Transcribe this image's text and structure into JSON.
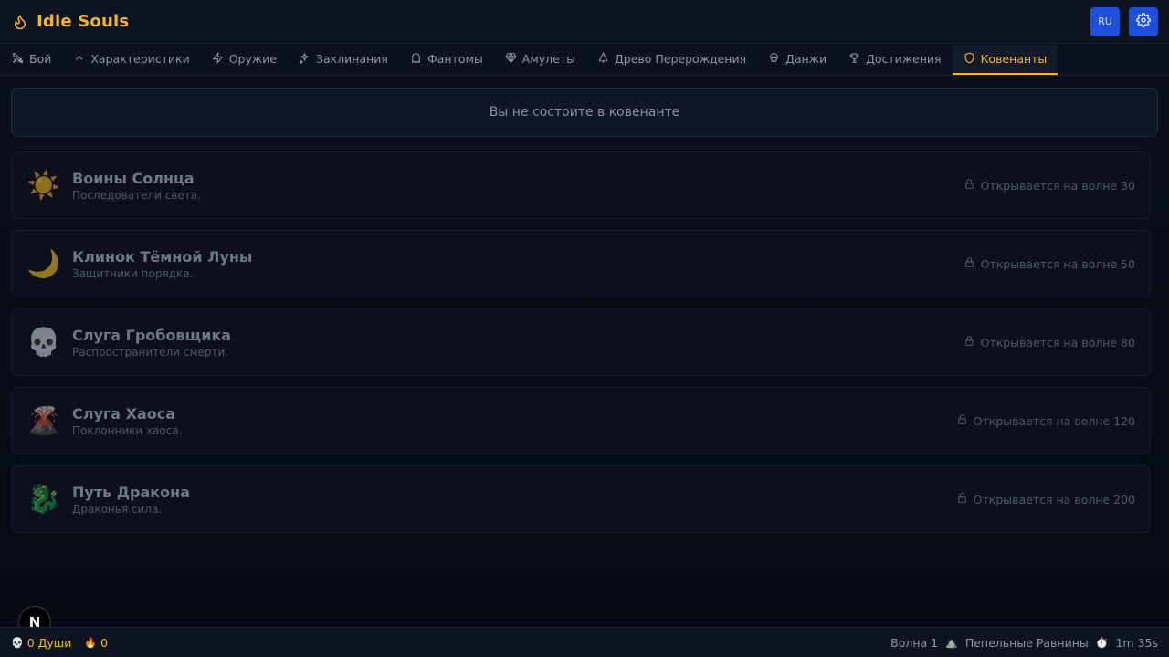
{
  "header": {
    "title": "Idle Souls",
    "lang_label": "RU",
    "brand_color": "#f5b623",
    "button_color": "#1d4fd8"
  },
  "tabs": [
    {
      "label": "Бой",
      "icon": "crossed-swords-icon"
    },
    {
      "label": "Характеристики",
      "icon": "chevron-up-icon"
    },
    {
      "label": "Оружие",
      "icon": "lightning-icon"
    },
    {
      "label": "Заклинания",
      "icon": "sparkles-icon"
    },
    {
      "label": "Фантомы",
      "icon": "ghost-icon"
    },
    {
      "label": "Амулеты",
      "icon": "gem-icon"
    },
    {
      "label": "Древо Перерождения",
      "icon": "tree-icon"
    },
    {
      "label": "Данжи",
      "icon": "skull-mask-icon"
    },
    {
      "label": "Достижения",
      "icon": "trophy-icon"
    },
    {
      "label": "Ковенанты",
      "icon": "shield-icon",
      "active": true
    }
  ],
  "status": {
    "text": "Вы не состоите в ковенанте"
  },
  "covenants": [
    {
      "emoji": "☀️",
      "name": "Воины Солнца",
      "desc": "Последователи света.",
      "lock": "Открывается на волне 30"
    },
    {
      "emoji": "🌙",
      "name": "Клинок Тёмной Луны",
      "desc": "Защитники порядка.",
      "lock": "Открывается на волне 50"
    },
    {
      "emoji": "💀",
      "name": "Слуга Гробовщика",
      "desc": "Распространители смерти.",
      "lock": "Открывается на волне 80"
    },
    {
      "emoji": "🌋",
      "name": "Слуга Хаоса",
      "desc": "Поклонники хаоса.",
      "lock": "Открывается на волне 120"
    },
    {
      "emoji": "🐉",
      "name": "Путь Дракона",
      "desc": "Драконья сила.",
      "lock": "Открывается на волне 200"
    }
  ],
  "footer": {
    "souls_icon": "💀",
    "souls": "0 Души",
    "flame_icon": "🔥",
    "flame": "0",
    "wave": "Волна 1",
    "location_icon": "⛰️",
    "location": "Пепельные Равнины",
    "timer_icon": "⏱️",
    "timer": "1m 35s"
  },
  "fab_label": "N"
}
